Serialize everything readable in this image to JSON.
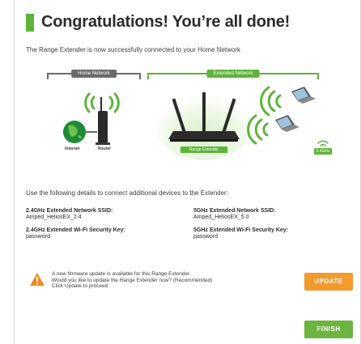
{
  "title": "Congratulations! You’re all done!",
  "subtitle": "The Range Extender is now successfully connected to your Home Network",
  "diagram": {
    "home_network": "Home Network",
    "extended_network": "Extended Network",
    "internet": "Internet",
    "router": "Router",
    "range_extender": "Range Extender",
    "band_label": "2.4GHz"
  },
  "instructions": "Use the following details to connect additional devices to the Extender:",
  "details": {
    "ssid_24_label": "2.4GHz Extended Network SSID:",
    "ssid_24_value": "Amped_HeliosEX_2.4",
    "key_24_label": "2.4GHz Extended Wi-Fi Security Key:",
    "key_24_value": "password",
    "ssid_5_label": "5GHz Extended Network SSID:",
    "ssid_5_value": "Amped_HeliosEX_5.0",
    "key_5_label": "5GHz Extended Wi-Fi Security Key:",
    "key_5_value": "password"
  },
  "firmware": {
    "line1": "A new firmware update is available for this Range Extender.",
    "line2": "Would you like to update the Range Extender now? (Recommended)",
    "line3": "Click Update to proceed."
  },
  "buttons": {
    "update": "UPDATE",
    "finish": "FINISH"
  },
  "colors": {
    "accent_green": "#5fb33a",
    "gray": "#6b6b6b",
    "update_orange": "#f39a2d",
    "warning_orange": "#f08a24"
  },
  "icons": [
    "warning-icon",
    "wifi-icon",
    "laptop-icon",
    "globe-icon",
    "router-icon",
    "range-extender-icon"
  ]
}
